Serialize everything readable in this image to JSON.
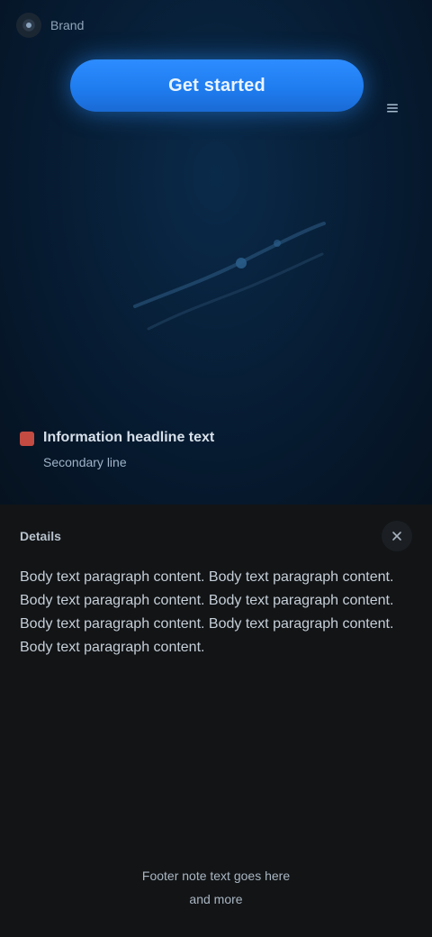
{
  "app": {
    "brand": "Brand"
  },
  "hero": {
    "cta_label": "Get started"
  },
  "info": {
    "title": "Information headline text",
    "subtitle": "Secondary line"
  },
  "panel": {
    "title": "Details",
    "body": "Body text paragraph content. Body text paragraph content. Body text paragraph content. Body text paragraph content. Body text paragraph content. Body text paragraph content. Body text paragraph content.",
    "footer_line1": "Footer note text goes here",
    "footer_line2": "and more"
  },
  "colors": {
    "accent": "#1f7df0",
    "hero_bg": "#071e36",
    "panel_bg": "#121416"
  },
  "icons": {
    "logo": "logo-icon",
    "menu": "menu-icon",
    "close": "close-icon",
    "flag": "flag-icon"
  }
}
